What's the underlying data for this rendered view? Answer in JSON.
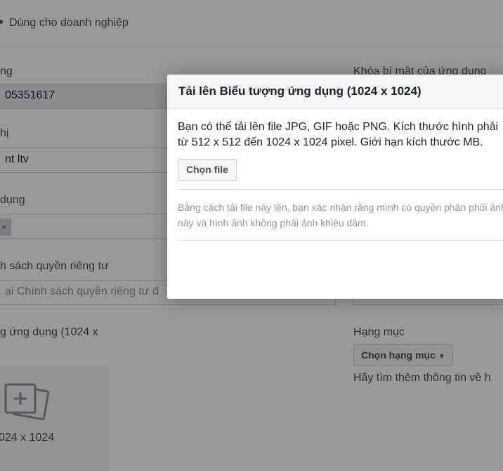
{
  "background": {
    "bullet_text": "Dùng cho doanh nghiệp",
    "left_col": {
      "app_id_label": "ng",
      "app_id_value": "05351617",
      "display_name_label": "hị",
      "display_name_value": "nt ltv",
      "app_domain_label": "dụng",
      "token_remove_symbol": "×",
      "privacy_label": "h sách quyền riêng tư",
      "privacy_placeholder": "ại Chính sách quyền riêng tư đ",
      "icon_label": "g ứng dụng (1024 x",
      "icon_hint": "024 x 1024"
    },
    "right_col": {
      "secret_label": "Khóa bí mật của ứng dụng",
      "category_label": "Hạng mục",
      "category_button": "Chọn hạng mục",
      "category_help": "Hãy tìm thêm thông tin về h"
    }
  },
  "dialog": {
    "title": "Tải lên Biểu tượng ứng dụng (1024 x 1024)",
    "description": "Bạn có thể tải lên file JPG, GIF hoặc PNG. Kích thước hình phải từ 512 x 512 đến 1024 x 1024 pixel. Giới hạn kích thước MB.",
    "choose_file_button": "Chọn file",
    "legal_text": "Bằng cách tải file này lên, bạn xác nhận rằng mình có quyền phân phối ảnh này và hình ảnh không phải ảnh khiêu dâm."
  },
  "colors": {
    "overlay": "#000000",
    "link": "#4267b2",
    "muted_text": "#90949c"
  }
}
